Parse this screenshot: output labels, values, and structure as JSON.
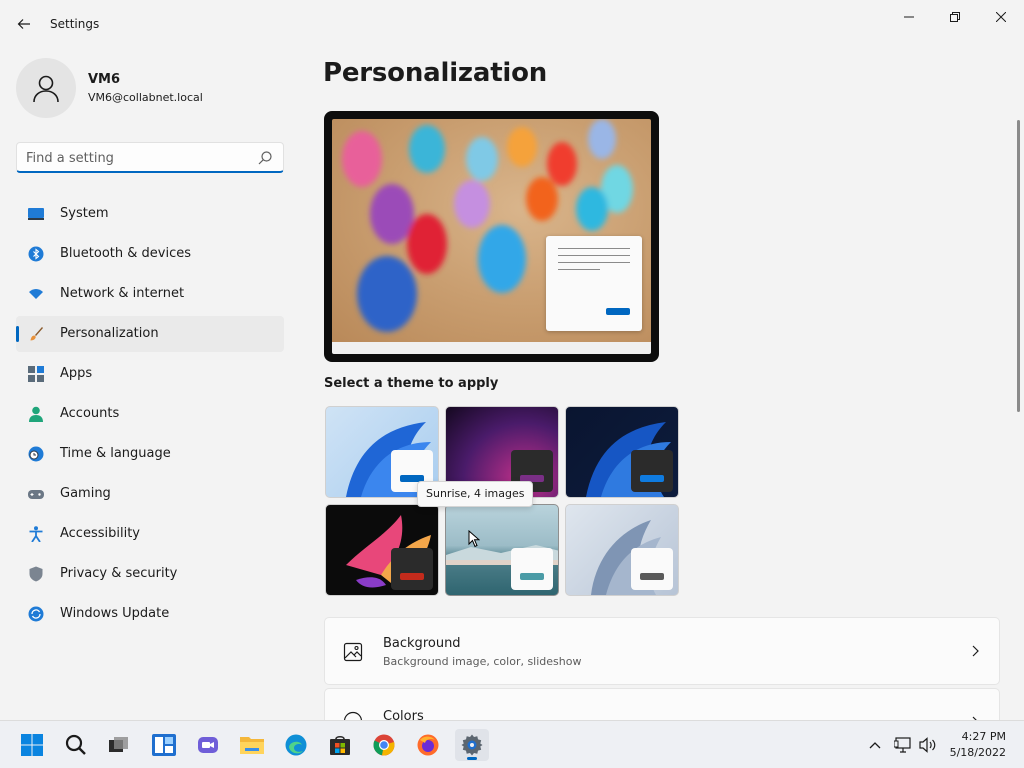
{
  "window": {
    "title": "Settings"
  },
  "profile": {
    "name": "VM6",
    "email": "VM6@collabnet.local"
  },
  "search": {
    "placeholder": "Find a setting",
    "value": ""
  },
  "nav": {
    "items": [
      {
        "label": "System",
        "icon": "monitor-icon"
      },
      {
        "label": "Bluetooth & devices",
        "icon": "bluetooth-icon"
      },
      {
        "label": "Network & internet",
        "icon": "wifi-icon"
      },
      {
        "label": "Personalization",
        "icon": "brush-icon",
        "active": true
      },
      {
        "label": "Apps",
        "icon": "apps-icon"
      },
      {
        "label": "Accounts",
        "icon": "person-icon"
      },
      {
        "label": "Time & language",
        "icon": "clock-globe-icon"
      },
      {
        "label": "Gaming",
        "icon": "gamepad-icon"
      },
      {
        "label": "Accessibility",
        "icon": "accessibility-icon"
      },
      {
        "label": "Privacy & security",
        "icon": "shield-icon"
      },
      {
        "label": "Windows Update",
        "icon": "update-icon"
      }
    ]
  },
  "main": {
    "title": "Personalization",
    "theme_section_label": "Select a theme to apply",
    "tooltip": "Sunrise, 4 images",
    "cards": [
      {
        "title": "Background",
        "subtitle": "Background image, color, slideshow",
        "icon": "picture-icon"
      },
      {
        "title": "Colors",
        "subtitle": "",
        "icon": "palette-icon"
      }
    ]
  },
  "taskbar": {
    "apps": [
      "start-icon",
      "search-icon",
      "task-view-icon",
      "widgets-icon",
      "chat-icon",
      "file-explorer-icon",
      "edge-icon",
      "store-icon",
      "chrome-icon",
      "firefox-icon",
      "settings-icon"
    ],
    "time": "4:27 PM",
    "date": "5/18/2022"
  },
  "colors": {
    "accent": "#0067c0",
    "theme_red": "#c42b1c",
    "theme_teal": "#4a9ba6",
    "theme_gray": "#5a5a5a"
  }
}
